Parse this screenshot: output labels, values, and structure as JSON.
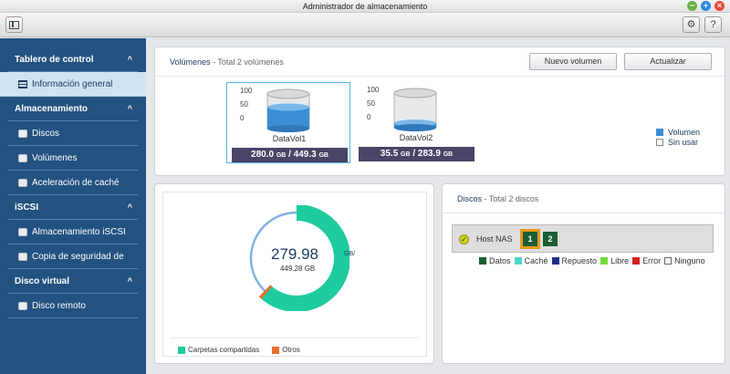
{
  "window": {
    "title": "Administrador de almacenamiento"
  },
  "sidebar": {
    "sections": [
      {
        "label": "Tablero de control",
        "items": [
          "Información general"
        ]
      },
      {
        "label": "Almacenamiento",
        "items": [
          "Discos",
          "Volúmenes",
          "Aceleración de caché"
        ]
      },
      {
        "label": "iSCSI",
        "items": [
          "Almacenamiento iSCSI",
          "Copia de seguridad de"
        ]
      },
      {
        "label": "Disco virtual",
        "items": [
          "Disco remoto"
        ]
      }
    ],
    "active_item": "Información general"
  },
  "volumes_panel": {
    "title": "Volúmenes",
    "subtitle": "- Total 2 volúmenes",
    "new_button": "Nuevo volumen",
    "refresh_button": "Actualizar",
    "scale_ticks": [
      "100",
      "50",
      "0"
    ],
    "volumes": [
      {
        "name": "DataVol1",
        "used": "280.0",
        "total": "449.3",
        "unit": "GB",
        "fill_fraction": 0.62,
        "selected": true
      },
      {
        "name": "DataVol2",
        "used": "35.5",
        "total": "283.9",
        "unit": "GB",
        "fill_fraction": 0.13,
        "selected": false
      }
    ],
    "legend": [
      {
        "label": "Volumen",
        "color": "#3a8fd6"
      },
      {
        "label": "Sin usar",
        "color": "#ffffff"
      }
    ]
  },
  "usage_panel": {
    "center_value": "279.98",
    "center_unit": "GB/",
    "center_total": "449.28 GB",
    "slices": [
      {
        "label": "Carpetas compartidas",
        "value": 449.28,
        "color": "#1ecb9e"
      },
      {
        "label": "Otros",
        "value": 4.5,
        "color": "#e8702a"
      }
    ],
    "remaining_color": "#7fb2e0",
    "used_value": 279.98,
    "total_value": 449.28
  },
  "disks_panel": {
    "title": "Discos",
    "subtitle": "- Total 2 discos",
    "host_label": "Host NAS",
    "slots": [
      "1",
      "2"
    ],
    "legend": [
      {
        "label": "Datos",
        "color": "#1a5e35"
      },
      {
        "label": "Caché",
        "color": "#4fd6c8"
      },
      {
        "label": "Repuesto",
        "color": "#1e2d86"
      },
      {
        "label": "Libre",
        "color": "#6fdc3a"
      },
      {
        "label": "Error",
        "color": "#d41f1f"
      },
      {
        "label": "Ninguno",
        "color": "#ffffff"
      }
    ]
  }
}
